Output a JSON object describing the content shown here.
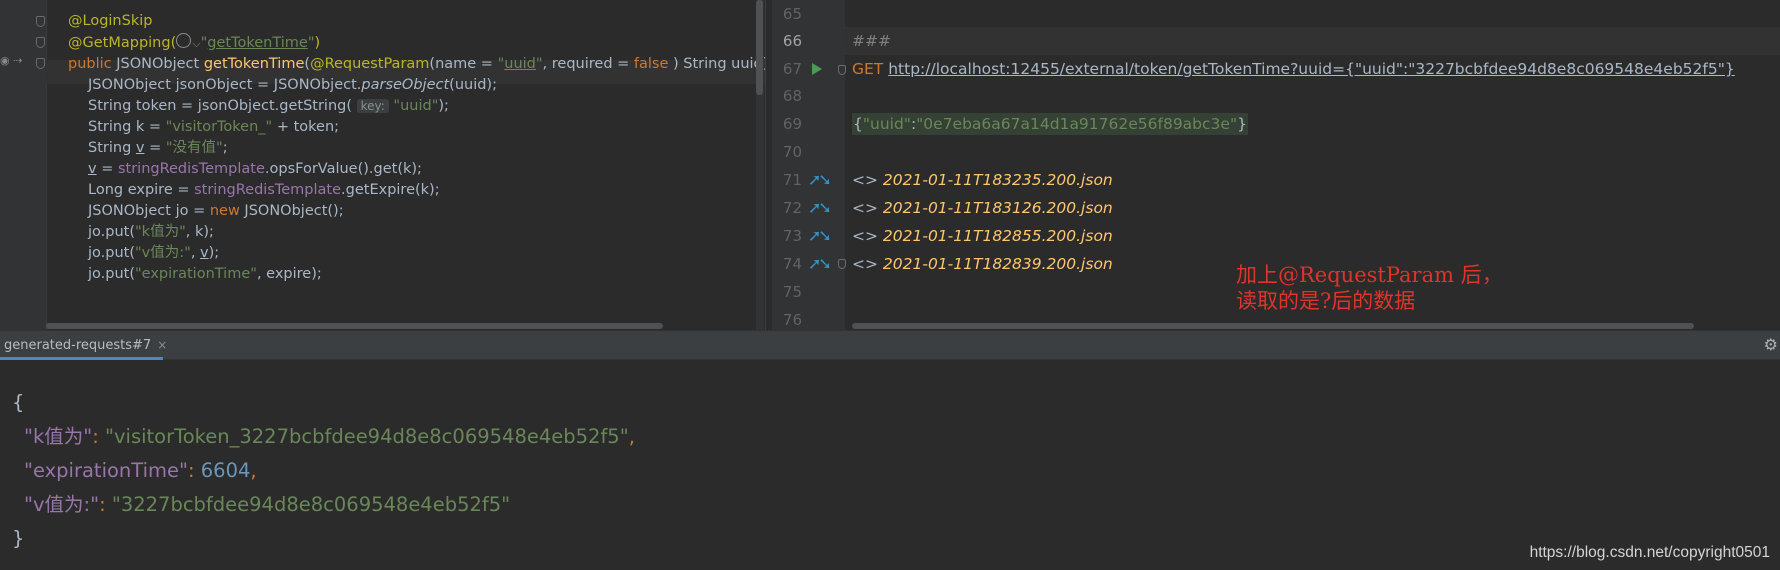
{
  "left_code": {
    "l1": "@LoginSkip",
    "l2": {
      "ann": "@GetMapping(",
      "str_open": "\"",
      "str": "getTokenTime",
      "str_close": "\"",
      "close": ")"
    },
    "l3": {
      "kw_public": "public ",
      "type": "JSONObject ",
      "method": "getTokenTime",
      "paren": "(",
      "ann": "@RequestParam",
      "p1": "(name = ",
      "str_q1": "\"",
      "str_uuid": "uuid",
      "str_q2": "\"",
      "p2": ", required = ",
      "kw_false": "false",
      "p3": " ) String uuid) {"
    },
    "l4": {
      "pre": "JSONObject jsonObject = JSONObject.",
      "call": "parseObject",
      "post": "(uuid);"
    },
    "l5": {
      "pre": "String token = jsonObject.getString( ",
      "hint": "key:",
      "str": " \"uuid\"",
      "post": ");"
    },
    "l6": {
      "pre": "String k = ",
      "str": "\"visitorToken_\"",
      "post": " + token;"
    },
    "l7": {
      "pre": "String ",
      "var": "v",
      "mid": " = ",
      "str": "\"没有值\"",
      "post": ";"
    },
    "l8": {
      "var": "v",
      "mid": " = ",
      "field": "stringRedisTemplate",
      "post": ".opsForValue().get(k);"
    },
    "l9": {
      "pre": "Long expire = ",
      "field": "stringRedisTemplate",
      "post": ".getExpire(k);"
    },
    "l10": {
      "pre": "JSONObject jo = ",
      "kw": "new",
      "post": " JSONObject();"
    },
    "l11": {
      "pre": "jo.put(",
      "str": "\"k值为\"",
      "post": ", k);"
    },
    "l12": {
      "pre": "jo.put(",
      "str": "\"v值为:\"",
      "mid": ", ",
      "var": "v",
      "post": ");"
    },
    "l13": {
      "pre": "jo.put(",
      "str": "\"expirationTime\"",
      "post": ", expire);"
    }
  },
  "right_editor": {
    "line_numbers": [
      "65",
      "66",
      "67",
      "68",
      "69",
      "70",
      "71",
      "72",
      "73",
      "74",
      "75",
      "76"
    ],
    "separator": "###",
    "method": "GET",
    "url": "http://localhost:12455/external/token/getTokenTime?uuid={\"uuid\":\"3227bcbfdee94d8e8c069548e4eb52f5\"}",
    "body": {
      "open": "{",
      "key": "\"uuid\"",
      "colon": ":",
      "val": "\"0e7eba6a67a14d1a91762e56f89abc3e\"",
      "close": "}"
    },
    "history_prefix": "<> ",
    "history": [
      "2021-01-11T183235.200.json",
      "2021-01-11T183126.200.json",
      "2021-01-11T182855.200.json",
      "2021-01-11T182839.200.json"
    ],
    "note_line1": "加上@RequestParam 后，",
    "note_line2": "读取的是?后的数据"
  },
  "tool_window": {
    "tab_label": "generated-requests#7",
    "close_glyph": "×"
  },
  "response": {
    "open": "{",
    "k_key": "\"k值为\"",
    "k_val": "\"visitorToken_3227bcbfdee94d8e8c069548e4eb52f5\"",
    "exp_key": "\"expirationTime\"",
    "exp_val": "6604",
    "v_key": "\"v值为:\"",
    "v_val": "\"3227bcbfdee94d8e8c069548e4eb52f5\"",
    "colon": ": ",
    "comma": ",",
    "close": "}"
  },
  "watermark": "https://blog.csdn.net/copyright0501",
  "colors": {
    "accent_tab": "#4a88c7",
    "annotation_red": "#e0332a"
  }
}
